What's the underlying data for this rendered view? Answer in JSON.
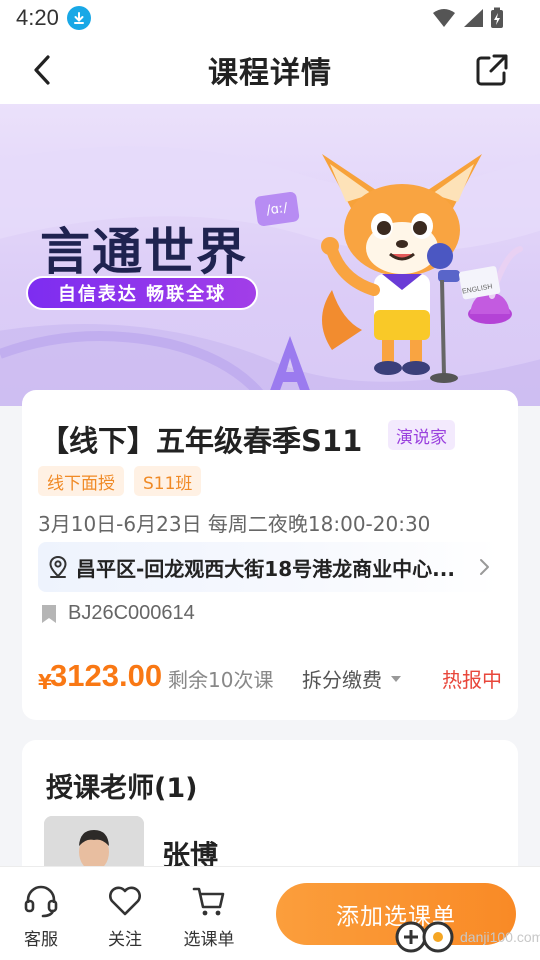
{
  "status_bar": {
    "time": "4:20"
  },
  "nav": {
    "title": "课程详情"
  },
  "banner": {
    "headline": "言通世界",
    "slogan": "自信表达 畅联全球",
    "phonetic_card": "/ɑː/",
    "podium_label": "ENGLISH"
  },
  "course": {
    "title": "【线下】五年级春季S11",
    "category_tag": "演说家",
    "tags": [
      "线下面授",
      "S11班"
    ],
    "schedule": "3月10日-6月23日  每周二夜晚18:00-20:30",
    "address": "昌平区-回龙观西大街18号港龙商业中心...",
    "code": "BJ26C000614",
    "price_currency": "¥",
    "price": "3123.00",
    "remaining": "剩余10次课",
    "split_payment": "拆分缴费",
    "status": "热报中"
  },
  "teacher_section": {
    "title": "授课老师(1)",
    "teachers": [
      {
        "name": "张博"
      }
    ]
  },
  "bottom_bar": {
    "service": "客服",
    "follow": "关注",
    "course_list": "选课单",
    "add_button": "添加选课单"
  },
  "watermark": {
    "text": "danji100.com"
  },
  "colors": {
    "accent_orange": "#f98a26",
    "price_orange": "#f97814",
    "hot_red": "#e8473b",
    "purple_tag": "#9a40de",
    "banner_purple": "#7d2df0"
  },
  "icons": [
    "download-icon",
    "wifi-icon",
    "signal-icon",
    "battery-icon",
    "back-arrow-icon",
    "share-icon",
    "location-icon",
    "chevron-right-icon",
    "bookmark-icon",
    "caret-down-icon",
    "headset-icon",
    "heart-icon",
    "cart-icon"
  ]
}
